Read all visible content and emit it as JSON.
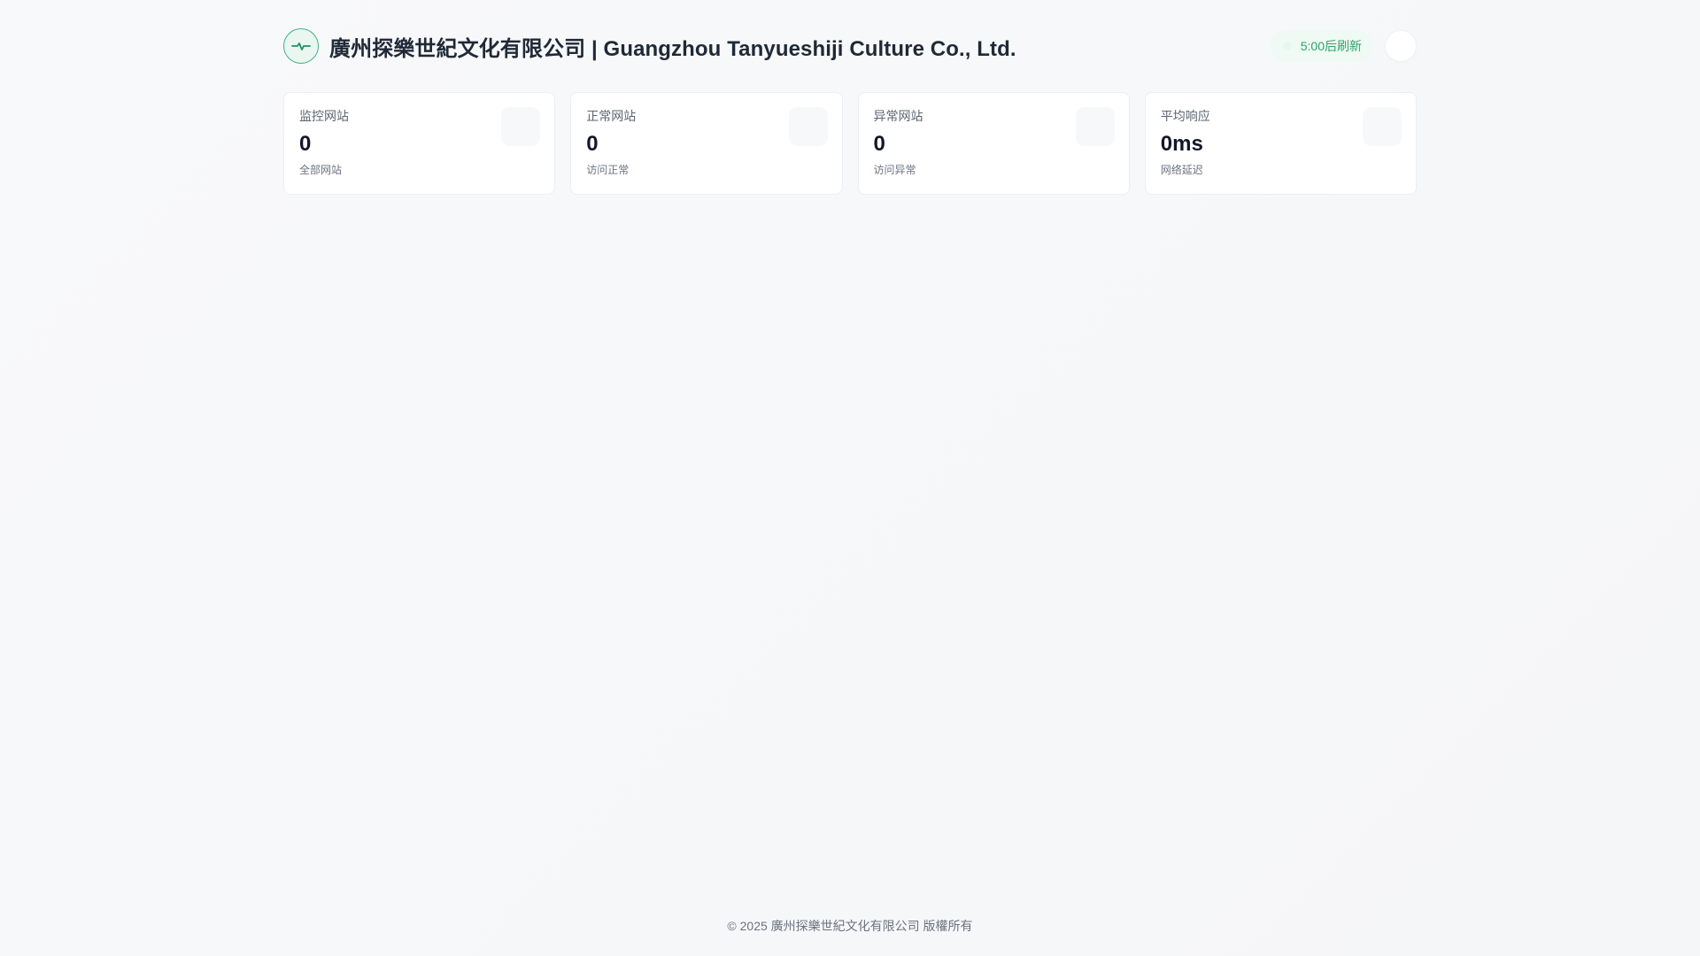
{
  "header": {
    "logo_icon": "heartbeat-icon",
    "title": "廣州探樂世紀文化有限公司 | Guangzhou Tanyueshiji Culture Co., Ltd.",
    "refresh_text": "5:00后刷新",
    "theme_toggle_icon": "theme-toggle-icon"
  },
  "stats": [
    {
      "label": "监控网站",
      "value": "0",
      "sub": "全部网站"
    },
    {
      "label": "正常网站",
      "value": "0",
      "sub": "访问正常"
    },
    {
      "label": "异常网站",
      "value": "0",
      "sub": "访问异常"
    },
    {
      "label": "平均响应",
      "value": "0ms",
      "sub": "网络延迟"
    }
  ],
  "footer": {
    "copyright": "© 2025 廣州探樂世紀文化有限公司 版權所有"
  },
  "colors": {
    "accent": "#3bb389",
    "refresh_text": "#2fa36b",
    "refresh_bg": "#eefaf3"
  }
}
